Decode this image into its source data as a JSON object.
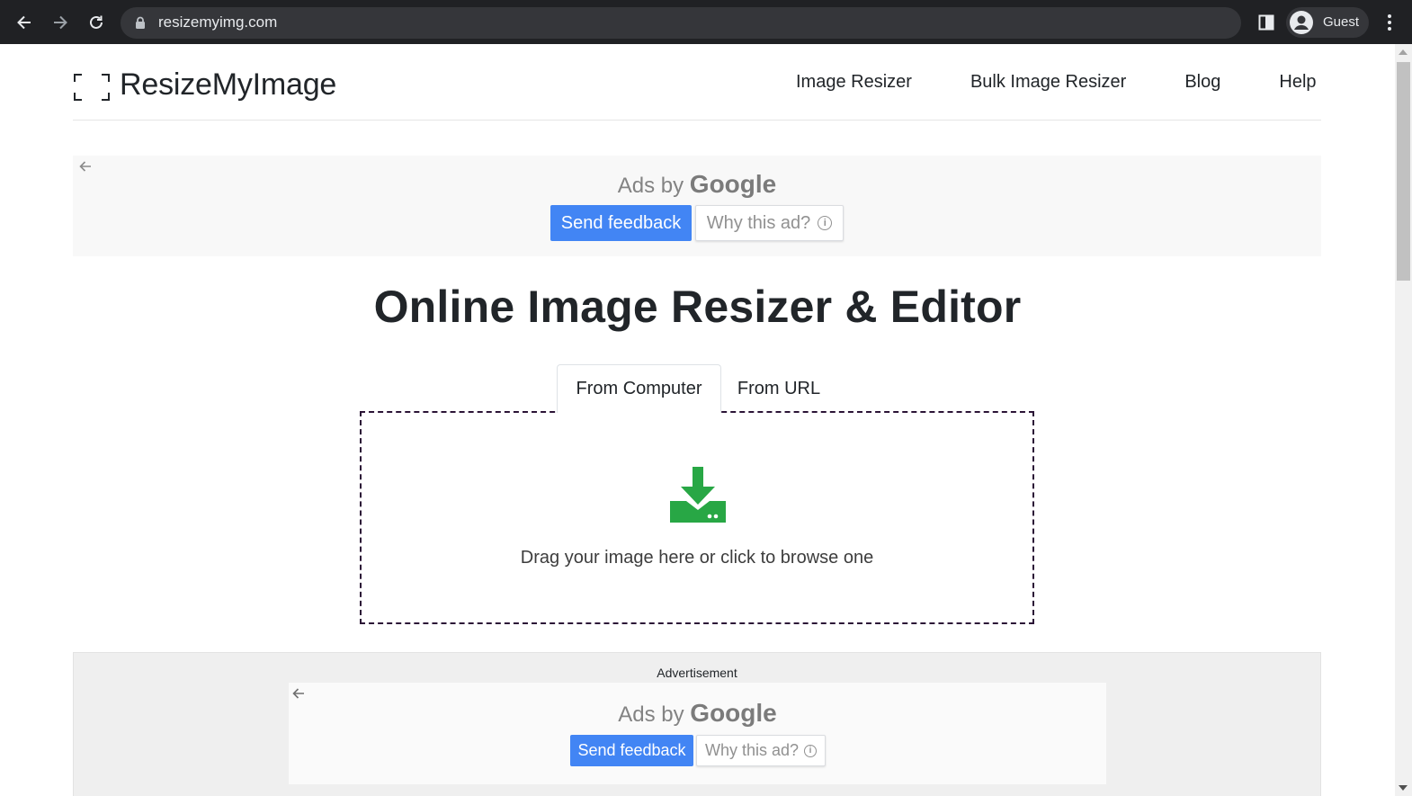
{
  "browser": {
    "url": "resizemyimg.com",
    "profile_name": "Guest"
  },
  "site": {
    "logo_text": "ResizeMyImage",
    "nav": [
      {
        "label": "Image Resizer"
      },
      {
        "label": "Bulk Image Resizer"
      },
      {
        "label": "Blog"
      },
      {
        "label": "Help"
      }
    ]
  },
  "ad_top": {
    "ads_by": "Ads by",
    "google": "Google",
    "send_feedback": "Send feedback",
    "why_this_ad": "Why this ad?",
    "info_glyph": "i"
  },
  "main": {
    "title": "Online Image Resizer & Editor",
    "tabs": [
      {
        "label": "From Computer",
        "active": true
      },
      {
        "label": "From URL",
        "active": false
      }
    ],
    "dropzone_text": "Drag your image here or click to browse one"
  },
  "ad_bottom": {
    "label": "Advertisement",
    "ads_by": "Ads by",
    "google": "Google",
    "send_feedback": "Send feedback",
    "why_this_ad": "Why this ad?",
    "info_glyph": "i"
  },
  "colors": {
    "feedback_blue": "#4285f4",
    "upload_green": "#28a745",
    "chrome_dark": "#202124"
  }
}
